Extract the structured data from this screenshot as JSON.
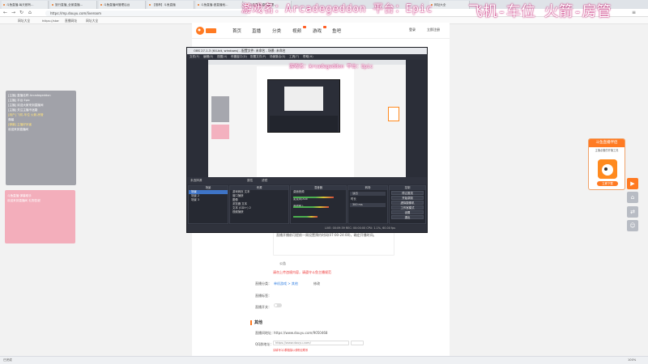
{
  "overlay": {
    "game_line": "游戏名：Arcadegeddon 平台：Epic",
    "plane_line": "飞机-车位  火箭-房管"
  },
  "browser": {
    "tabs": [
      "斗鱼直播-每天都有...",
      "旅行直播_全景直播...",
      "斗鱼直播间管理后台",
      "【推荐】斗鱼直播",
      "斗鱼直播-做直播就...",
      "斗鱼直播-直播管理..."
    ],
    "tab_extra": "网址大全",
    "url": "https://mp.douyu.com/liveroom",
    "bookmarks": [
      "网址大全",
      "https://star",
      "直播网址",
      "网址大全"
    ]
  },
  "site": {
    "nav": [
      "首页",
      "直播",
      "分类",
      "视频",
      "游戏",
      "鱼吧"
    ],
    "login": "登录",
    "register": "立即注册"
  },
  "form": {
    "hint_time": "直播开播前可提前一周设置预约时间(07:00-24:00)，确定开播时间。",
    "notice_title": "公告",
    "notice_red": "请勿上传违规内容，请遵守斗鱼主播规范",
    "category_label": "直播分类：",
    "category_value": "单机游戏 > 其他",
    "category_link": "修改",
    "tag_label": "直播标签：",
    "auto_label": "直播开关：",
    "section_title": "其他",
    "room_label": "直播间地址：",
    "room_value": "https://www.douyu.com/9050468",
    "qq_label": "QQ群地址：",
    "qq_value": "https://www.douyu.com/",
    "qq_hint": "请填写QQ群链接以便粉丝联系"
  },
  "obs": {
    "title": "OBS 27.1.3 (64-bit, windows) - 配置文件: 未命名 - 场景: 未命名",
    "menu": [
      "文件(F)",
      "编辑(E)",
      "视图(V)",
      "停靠窗口(D)",
      "配置文件(P)",
      "场景集合(S)",
      "工具(T)",
      "帮助(H)"
    ],
    "status_left": "未选择源",
    "status_props": "属性",
    "status_filter": "滤镜",
    "docks": {
      "scenes": {
        "title": "场景",
        "items": [
          "场景",
          "场景 2",
          "场景 3"
        ]
      },
      "sources": {
        "title": "来源",
        "items": [
          "游戏网页 文本",
          "窗口捕获",
          "图像",
          "浏览器 文本",
          "文本 (GDI+) 2",
          "视频捕获"
        ]
      },
      "mixer": {
        "title": "混音器",
        "tracks": [
          "桌面音频",
          "麦克风/Aux",
          "音频输入"
        ]
      },
      "transitions": {
        "title": "转场",
        "type": "淡出",
        "duration_label": "时长",
        "duration": "300 ms"
      },
      "controls": {
        "title": "控制",
        "buttons": [
          "停止推流",
          "开始录制",
          "虚拟摄像机",
          "工作室模式",
          "设置",
          "退出"
        ]
      }
    },
    "footer": "LIVE: 00:09:39  REC: 00:00:00  CPU: 1.1%, 60.00 fps"
  },
  "chat1": {
    "lines": [
      "[主播] 直播名称 Arcadegeddon",
      "[主播] 平台 Epic",
      "[主播] 欢迎大家来到直播间",
      "[主播] 关注主播不迷路",
      "",
      "[用户] 飞机-车位 火箭-房管",
      "弹幕",
      "",
      "",
      "[弹幕] 主播好厉害",
      "欢迎来到直播间"
    ]
  },
  "chat2": {
    "lines": [
      "斗鱼直播 弹幕助手",
      "欢迎来到直播间 礼物答谢"
    ]
  },
  "assistant": {
    "title": "斗鱼直播伴侣",
    "subtitle": "主播必备的开播工具",
    "button": "立即下载"
  },
  "taskbar": {
    "left": "已完成",
    "right": "100%"
  }
}
